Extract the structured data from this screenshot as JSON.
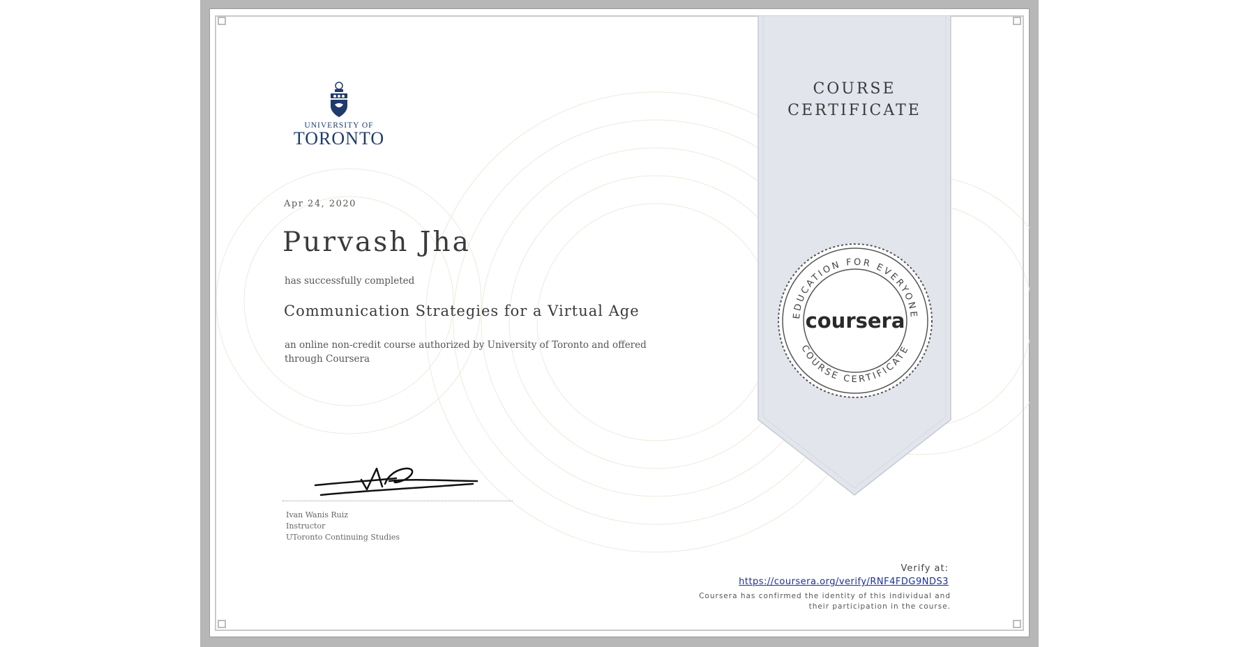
{
  "institution": {
    "logo_line1": "UNIVERSITY OF",
    "logo_line2": "TORONTO",
    "brand_color": "#1f3b6b"
  },
  "certificate": {
    "date": "Apr 24, 2020",
    "recipient": "Purvash Jha",
    "completed_text": "has successfully completed",
    "course_title": "Communication Strategies for a Virtual Age",
    "description": "an online non-credit course authorized by University of Toronto and offered through Coursera",
    "ribbon_line1": "COURSE",
    "ribbon_line2": "CERTIFICATE"
  },
  "instructor": {
    "name": "Ivan Wanis Ruiz",
    "role": "Instructor",
    "organization": "UToronto Continuing Studies"
  },
  "seal": {
    "brand": "coursera",
    "top_arc": "EDUCATION FOR EVERYONE",
    "bottom_arc": "COURSE CERTIFICATE"
  },
  "verification": {
    "label": "Verify at:",
    "url": "https://coursera.org/verify/RNF4FDG9NDS3",
    "note_line1": "Coursera has confirmed the identity of this individual and",
    "note_line2": "their participation in the course."
  },
  "colors": {
    "frame": "#b7b7b7",
    "ribbon": "#e2e6ec",
    "link": "#1a2f9e",
    "text": "#3a3a3a"
  }
}
